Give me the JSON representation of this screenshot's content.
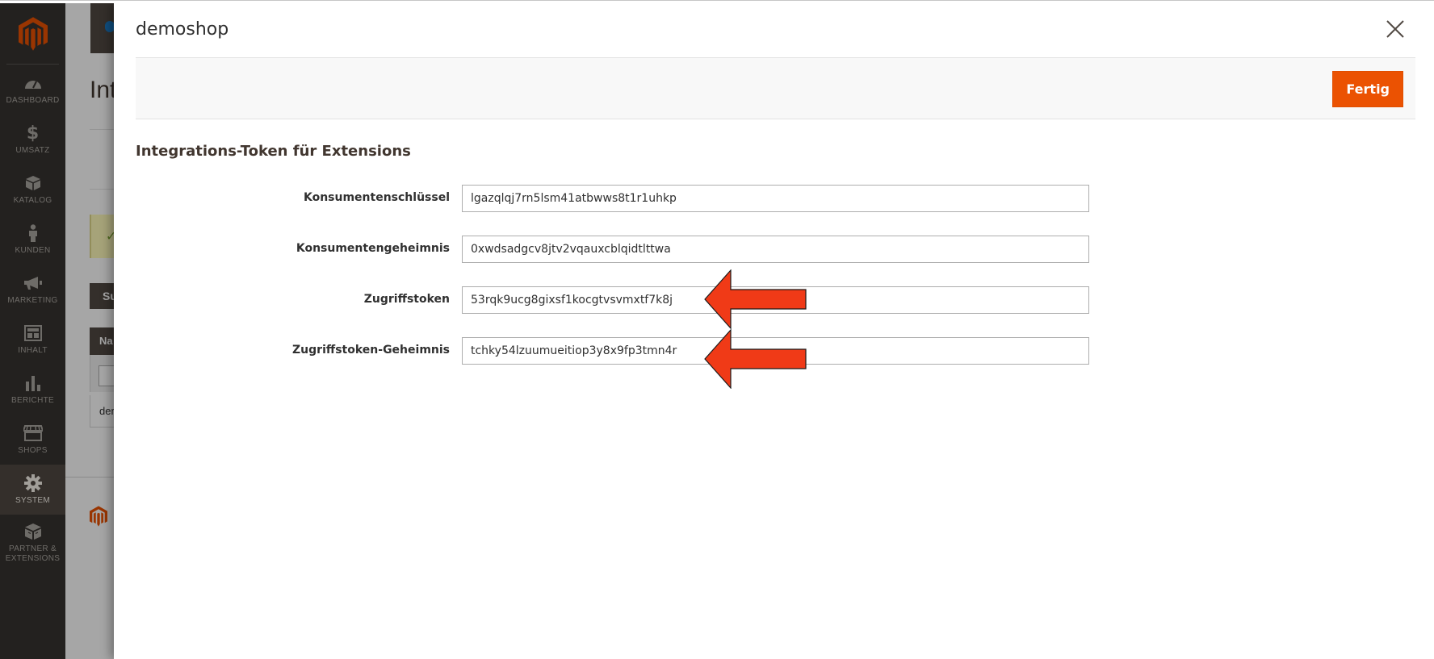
{
  "sidebar": {
    "items": [
      {
        "label": "DASHBOARD",
        "icon": "dashboard-icon"
      },
      {
        "label": "UMSATZ",
        "icon": "dollar-icon"
      },
      {
        "label": "KATALOG",
        "icon": "box-icon"
      },
      {
        "label": "KUNDEN",
        "icon": "person-icon"
      },
      {
        "label": "MARKETING",
        "icon": "megaphone-icon"
      },
      {
        "label": "INHALT",
        "icon": "layout-icon"
      },
      {
        "label": "BERICHTE",
        "icon": "bar-chart-icon"
      },
      {
        "label": "SHOPS",
        "icon": "storefront-icon"
      },
      {
        "label": "SYSTEM",
        "icon": "gear-icon",
        "active": true
      },
      {
        "label": "PARTNER & EXTENSIONS",
        "icon": "extensions-box-icon"
      }
    ]
  },
  "background_page": {
    "title_partial": "Int",
    "subhead_partial": "Su",
    "table_header_partial": "Na",
    "row_partial": "der"
  },
  "modal": {
    "title": "demoshop",
    "done_label": "Fertig",
    "section_title": "Integrations-Token für Extensions",
    "fields": [
      {
        "label": "Konsumentenschlüssel",
        "value": "lgazqlqj7rn5lsm41atbwws8t1r1uhkp",
        "highlighted": false
      },
      {
        "label": "Konsumentengeheimnis",
        "value": "0xwdsadgcv8jtv2vqauxcblqidtlttwa",
        "highlighted": false
      },
      {
        "label": "Zugriffstoken",
        "value": "53rqk9ucg8gixsf1kocgtvsvmxtf7k8j",
        "highlighted": true
      },
      {
        "label": "Zugriffstoken-Geheimnis",
        "value": "tchky54lzuumueitiop3y8x9fp3tmn4r",
        "highlighted": true
      }
    ]
  },
  "colors": {
    "sidebar_bg": "#373330",
    "accent_orange": "#eb5202",
    "arrow_red": "#f03a17"
  }
}
